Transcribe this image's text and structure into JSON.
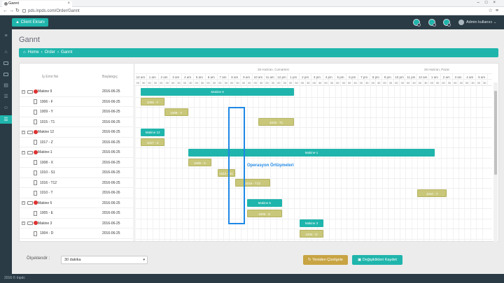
{
  "browser": {
    "tab_title": "Gannt",
    "url": "pds.inpds.com/Order/Gannt"
  },
  "header": {
    "client_button": "Client Ekranı",
    "user": "Admin kullanıcı"
  },
  "page": {
    "title": "Gannt",
    "breadcrumb": [
      "Home",
      "›",
      "Order",
      "›",
      "Gannt"
    ]
  },
  "grid": {
    "col_name": "İş Emri No",
    "col_start": "Başlangıç",
    "days": [
      "26 Haziran, Cumartesi",
      "26 Haziran, Pazar"
    ],
    "hours": [
      "12 am",
      "1 am",
      "2 am",
      "3 am",
      "4 am",
      "5 am",
      "6 am",
      "7 am",
      "8 am",
      "9 am",
      "10 am",
      "11 am",
      "12 pm",
      "1 pm",
      "2 pm",
      "3 pm",
      "4 pm",
      "5 pm",
      "6 pm",
      "7 pm",
      "8 pm",
      "9 pm",
      "10 pm",
      "11 pm",
      "12 am",
      "1 am",
      "2 am",
      "3 am",
      "4 am",
      "5 am"
    ],
    "minute_marks": [
      "00",
      "30"
    ],
    "rows": [
      {
        "type": "group",
        "name": "Makine 9",
        "date": "2016-06-25"
      },
      {
        "type": "task",
        "name": "1006 - F",
        "date": "2016-06-25"
      },
      {
        "type": "task",
        "name": "1009 - Y",
        "date": "2016-06-25"
      },
      {
        "type": "task",
        "name": "1015 - T1",
        "date": "2016-06-25"
      },
      {
        "type": "group",
        "name": "Makine 12",
        "date": "2016-06-25"
      },
      {
        "type": "task",
        "name": "1017 - Z",
        "date": "2016-06-25"
      },
      {
        "type": "group",
        "name": "Makine-1",
        "date": "2016-06-25"
      },
      {
        "type": "task",
        "name": "1008 - X",
        "date": "2016-06-25"
      },
      {
        "type": "task",
        "name": "1010 - S1",
        "date": "2016-06-25"
      },
      {
        "type": "task",
        "name": "1016 - T12",
        "date": "2016-06-25"
      },
      {
        "type": "task",
        "name": "1010 - T",
        "date": "2016-06-26"
      },
      {
        "type": "group",
        "name": "Makine 5",
        "date": "2016-06-25"
      },
      {
        "type": "task",
        "name": "1005 - E",
        "date": "2016-06-25"
      },
      {
        "type": "group",
        "name": "Makine 3",
        "date": "2016-06-25"
      },
      {
        "type": "task",
        "name": "1004 - D",
        "date": "2016-06-25"
      }
    ],
    "bars": [
      {
        "row": 0,
        "label": "Makine 9",
        "start": "00:30",
        "end": "13:30",
        "kind": "group"
      },
      {
        "row": 1,
        "label": "1006 - F",
        "start": "00:30",
        "end": "02:30",
        "kind": "task"
      },
      {
        "row": 2,
        "label": "1009 - Y",
        "start": "02:30",
        "end": "04:30",
        "kind": "task"
      },
      {
        "row": 3,
        "label": "1015 - T1",
        "start": "10:30",
        "end": "13:30",
        "kind": "task"
      },
      {
        "row": 4,
        "label": "Makine 12",
        "start": "00:30",
        "end": "02:30",
        "kind": "group"
      },
      {
        "row": 5,
        "label": "1017 - Z",
        "start": "00:30",
        "end": "02:30",
        "kind": "task"
      },
      {
        "row": 6,
        "label": "Makine-1",
        "start": "04:30",
        "end": "25:30",
        "kind": "group"
      },
      {
        "row": 7,
        "label": "1008 - X",
        "start": "04:30",
        "end": "06:30",
        "kind": "task"
      },
      {
        "row": 8,
        "label": "1010 - S1",
        "start": "07:00",
        "end": "08:30",
        "kind": "task"
      },
      {
        "row": 9,
        "label": "1016 - T12",
        "start": "08:30",
        "end": "11:30",
        "kind": "task"
      },
      {
        "row": 10,
        "label": "1010 - T",
        "start": "24:00",
        "end": "26:30",
        "kind": "task"
      },
      {
        "row": 11,
        "label": "Makine 5",
        "start": "09:30",
        "end": "12:30",
        "kind": "group"
      },
      {
        "row": 12,
        "label": "1005 - E",
        "start": "09:30",
        "end": "12:30",
        "kind": "task"
      },
      {
        "row": 13,
        "label": "Makine 3",
        "start": "14:00",
        "end": "16:00",
        "kind": "group"
      },
      {
        "row": 14,
        "label": "1004 - D",
        "start": "14:00",
        "end": "16:00",
        "kind": "task"
      }
    ],
    "annotation": "Operasyon Örtüşmeleri"
  },
  "footer_controls": {
    "scale_label": "Ölçeklendir :",
    "scale_value": "30 dakika",
    "reset_button": "Yeniden Çizelgele",
    "save_button": "Değişiklikleri Kaydet"
  },
  "footer": {
    "copyright": "2016 © Inpdc"
  },
  "colors": {
    "teal": "#1fb5ac",
    "olive": "#c9c77a",
    "header": "#2a3b45",
    "annotation": "#1e88e5",
    "reset": "#c8a443"
  }
}
